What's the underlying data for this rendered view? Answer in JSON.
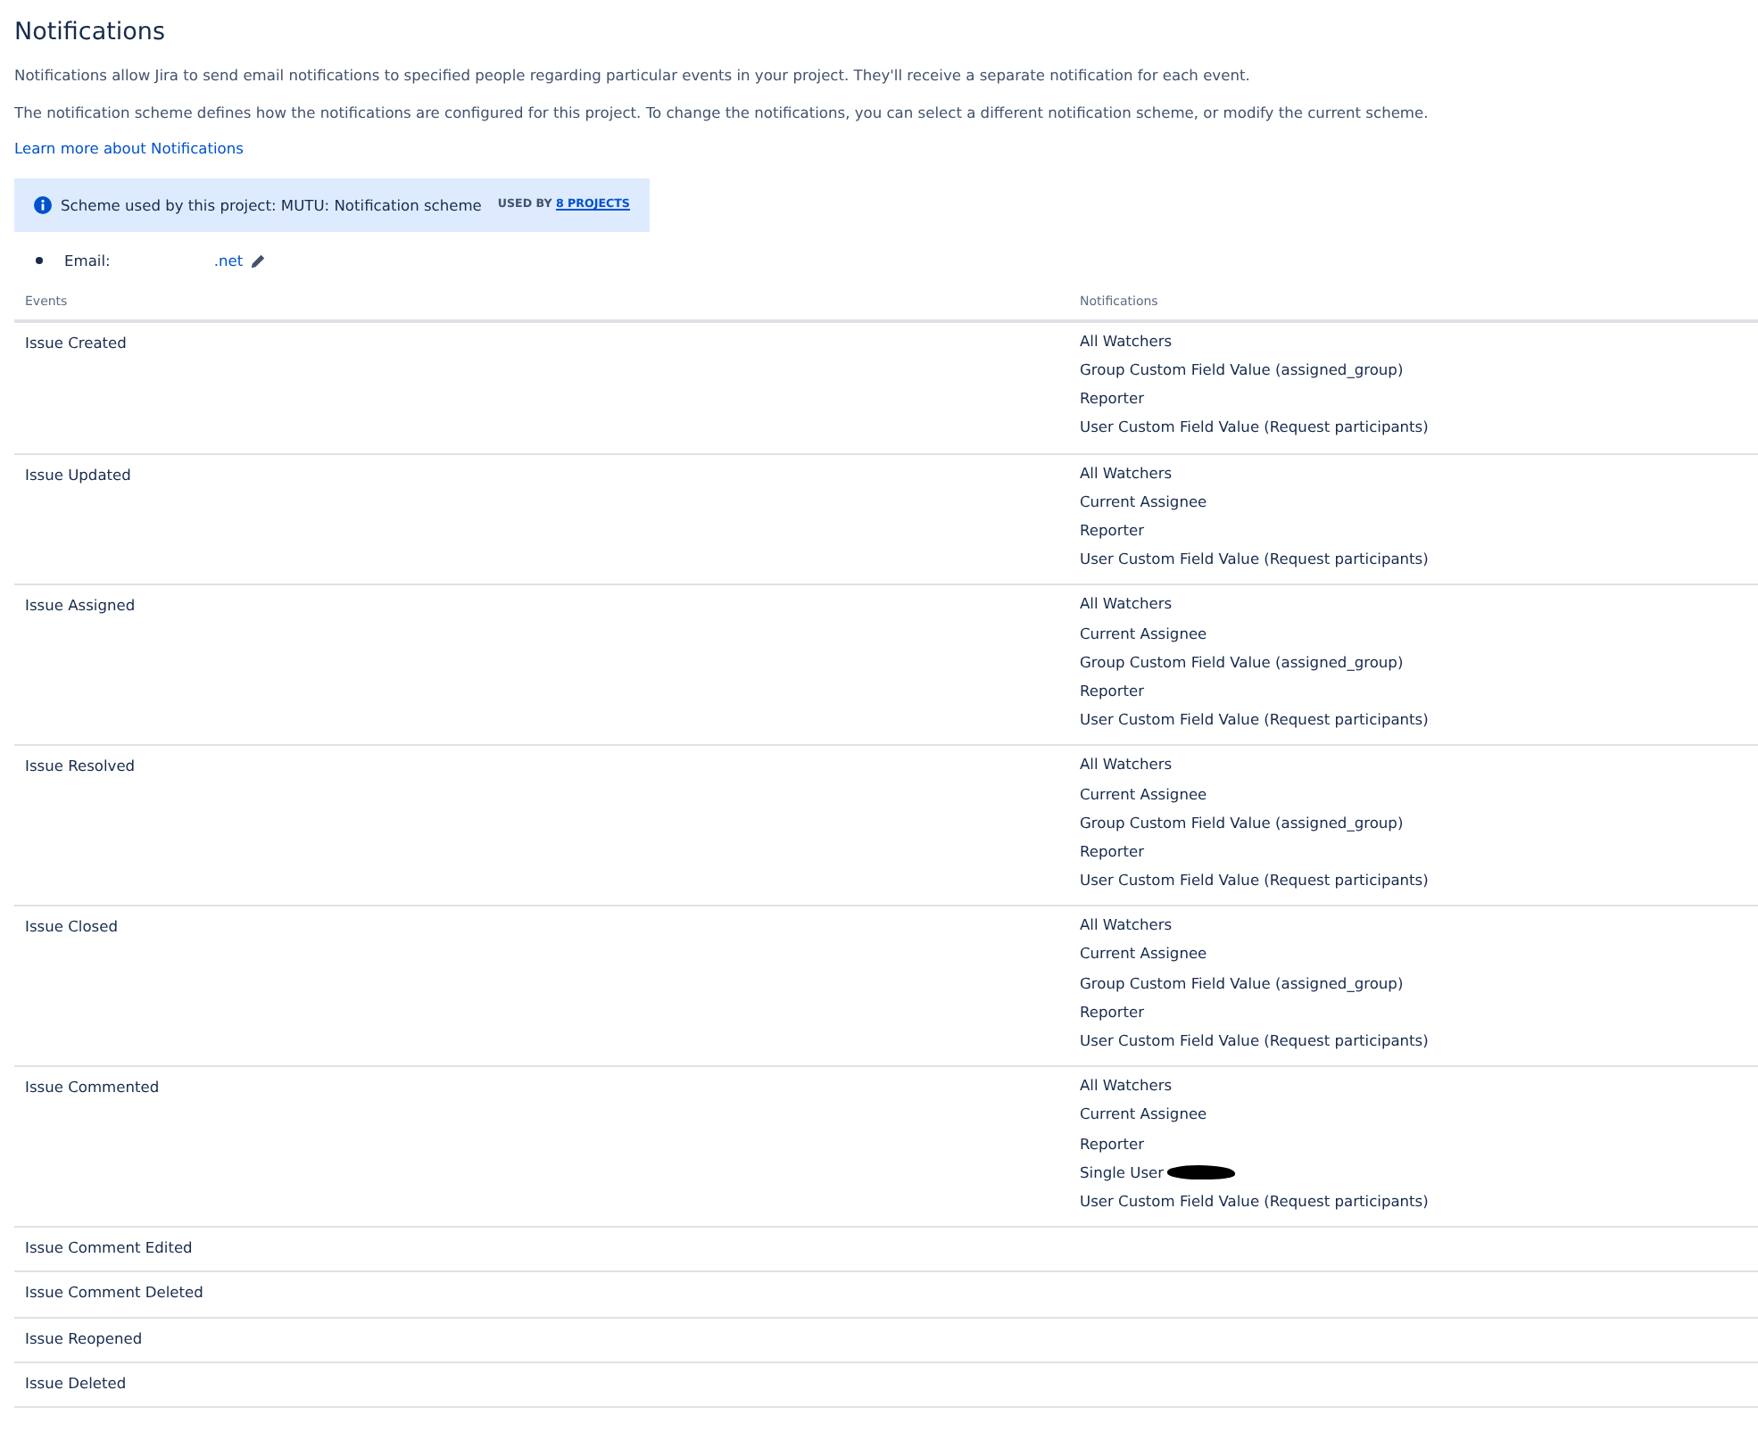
{
  "title": "Notifications",
  "paragraphs": [
    "Notifications allow Jira to send email notifications to specified people regarding particular events in your project. They'll receive a separate notification for each event.",
    "The notification scheme defines how the notifications are configured for this project. To change the notifications, you can select a different notification scheme, or modify the current scheme."
  ],
  "learn_more_link": "Learn more about Notifications",
  "scheme_banner": {
    "text": "Scheme used by this project: MUTU: Notification scheme",
    "used_by_label": "USED BY",
    "used_by_link": "8 PROJECTS"
  },
  "email": {
    "label": "Email:",
    "value": ".net"
  },
  "table": {
    "columns": [
      "Events",
      "Notifications"
    ],
    "rows": [
      {
        "event": "Issue Created",
        "notifications": [
          {
            "text": "All Watchers"
          },
          {
            "text": "Group Custom Field Value (assigned_group)"
          },
          {
            "text": "Reporter"
          },
          {
            "text": "User Custom Field Value (Request participants)"
          }
        ]
      },
      {
        "event": "Issue Updated",
        "notifications": [
          {
            "text": "All Watchers"
          },
          {
            "text": "Current Assignee"
          },
          {
            "text": "Reporter"
          },
          {
            "text": "User Custom Field Value (Request participants)"
          }
        ]
      },
      {
        "event": "Issue Assigned",
        "notifications": [
          {
            "text": "All Watchers"
          },
          {
            "text": "Current Assignee"
          },
          {
            "text": "Group Custom Field Value (assigned_group)"
          },
          {
            "text": "Reporter"
          },
          {
            "text": "User Custom Field Value (Request participants)"
          }
        ]
      },
      {
        "event": "Issue Resolved",
        "notifications": [
          {
            "text": "All Watchers"
          },
          {
            "text": "Current Assignee"
          },
          {
            "text": "Group Custom Field Value (assigned_group)"
          },
          {
            "text": "Reporter"
          },
          {
            "text": "User Custom Field Value (Request participants)"
          }
        ]
      },
      {
        "event": "Issue Closed",
        "notifications": [
          {
            "text": "All Watchers"
          },
          {
            "text": "Current Assignee"
          },
          {
            "text": "Group Custom Field Value (assigned_group)"
          },
          {
            "text": "Reporter"
          },
          {
            "text": "User Custom Field Value (Request participants)"
          }
        ]
      },
      {
        "event": "Issue Commented",
        "notifications": [
          {
            "text": "All Watchers"
          },
          {
            "text": "Current Assignee"
          },
          {
            "text": "Reporter"
          },
          {
            "text": "Single User",
            "redacted": true
          },
          {
            "text": "User Custom Field Value (Request participants)"
          }
        ]
      },
      {
        "event": "Issue Comment Edited",
        "notifications": []
      },
      {
        "event": "Issue Comment Deleted",
        "notifications": []
      },
      {
        "event": "Issue Reopened",
        "notifications": []
      },
      {
        "event": "Issue Deleted",
        "notifications": []
      }
    ]
  }
}
